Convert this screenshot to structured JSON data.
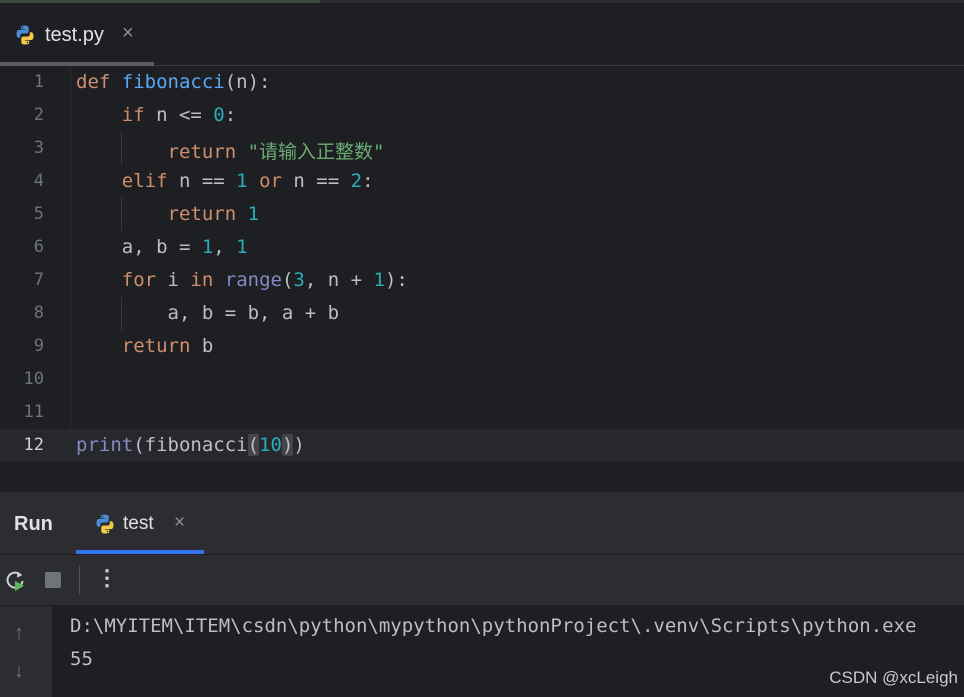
{
  "editor": {
    "tab": {
      "name": "test.py",
      "close": "×",
      "icon": "python-icon"
    },
    "lines": [
      "1",
      "2",
      "3",
      "4",
      "5",
      "6",
      "7",
      "8",
      "9",
      "10",
      "11",
      "12"
    ],
    "current_line": "12",
    "code": {
      "l1": {
        "kw": "def",
        "fn": "fibonacci",
        "rest": "(n):"
      },
      "l2": {
        "kw": "if",
        "mid": " n <= ",
        "num": "0",
        "end": ":"
      },
      "l3": {
        "kw": "return",
        "str": "\"请输入正整数\""
      },
      "l4": {
        "kw1": "elif",
        "a": " n == ",
        "n1": "1",
        "kw2": "or",
        "b": " n == ",
        "n2": "2",
        "end": ":"
      },
      "l5": {
        "kw": "return",
        "num": "1"
      },
      "l6": {
        "a": "a, b = ",
        "n1": "1",
        "sep": ", ",
        "n2": "1"
      },
      "l7": {
        "kw1": "for",
        "a": " i ",
        "kw2": "in",
        "builtin": "range",
        "p1": "(",
        "n1": "3",
        "b": ", n + ",
        "n2": "1",
        "end": "):"
      },
      "l8": {
        "text": "a, b = b, a + b"
      },
      "l9": {
        "kw": "return",
        "rest": " b"
      },
      "l12": {
        "builtin": "print",
        "p1": "(fibonacci",
        "ob": "(",
        "num": "10",
        "cb": ")",
        "p2": ")"
      }
    }
  },
  "run": {
    "title": "Run",
    "tab": {
      "name": "test",
      "close": "×",
      "icon": "python-icon"
    },
    "toolbar": {
      "rerun": "rerun-icon",
      "stop": "stop-icon",
      "more": "⋮"
    },
    "console": {
      "up": "↑",
      "down": "↓",
      "lines": [
        "D:\\MYITEM\\ITEM\\csdn\\python\\mypython\\pythonProject\\.venv\\Scripts\\python.exe",
        "55"
      ]
    }
  },
  "watermark": "CSDN @xcLeigh",
  "colors": {
    "background": "#1e1f22",
    "panel": "#2b2d30",
    "keyword": "#cf8e6d",
    "function": "#56a8f5",
    "number": "#2aacb8",
    "string": "#6aab73",
    "builtin": "#8888c6",
    "accent": "#3574f0"
  }
}
